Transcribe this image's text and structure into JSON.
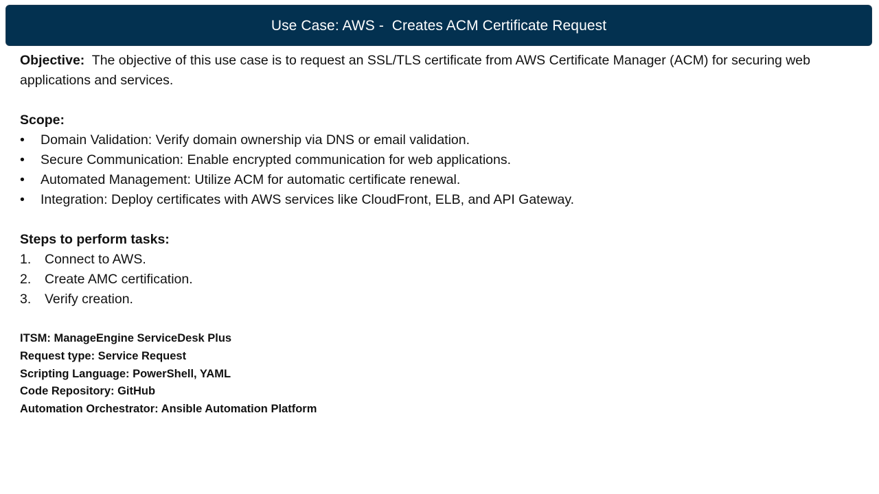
{
  "header": {
    "title": "Use Case: AWS -  Creates ACM Certificate Request"
  },
  "objective": {
    "label": "Objective:",
    "text": "The objective of this use case is to request an SSL/TLS certificate from AWS Certificate Manager (ACM) for securing web applications and services."
  },
  "scope": {
    "title": "Scope:",
    "marker": "•",
    "items": [
      "Domain Validation: Verify domain ownership via DNS or email validation.",
      "Secure Communication: Enable encrypted communication for web applications.",
      "Automated Management: Utilize ACM for automatic certificate renewal.",
      "Integration: Deploy certificates with AWS services like CloudFront, ELB, and API Gateway."
    ]
  },
  "steps": {
    "title": "Steps to perform tasks:",
    "items": [
      {
        "number": "1.",
        "text": "Connect to AWS."
      },
      {
        "number": "2.",
        "text": "Create AMC certification."
      },
      {
        "number": "3.",
        "text": "Verify creation."
      }
    ]
  },
  "meta": [
    "ITSM: ManageEngine ServiceDesk Plus",
    "Request type: Service Request",
    "Scripting Language: PowerShell, YAML",
    "Code Repository: GitHub",
    "Automation Orchestrator: Ansible Automation Platform"
  ],
  "colors": {
    "header_background": "#033150",
    "header_text": "#ffffff",
    "body_text": "#111111"
  }
}
